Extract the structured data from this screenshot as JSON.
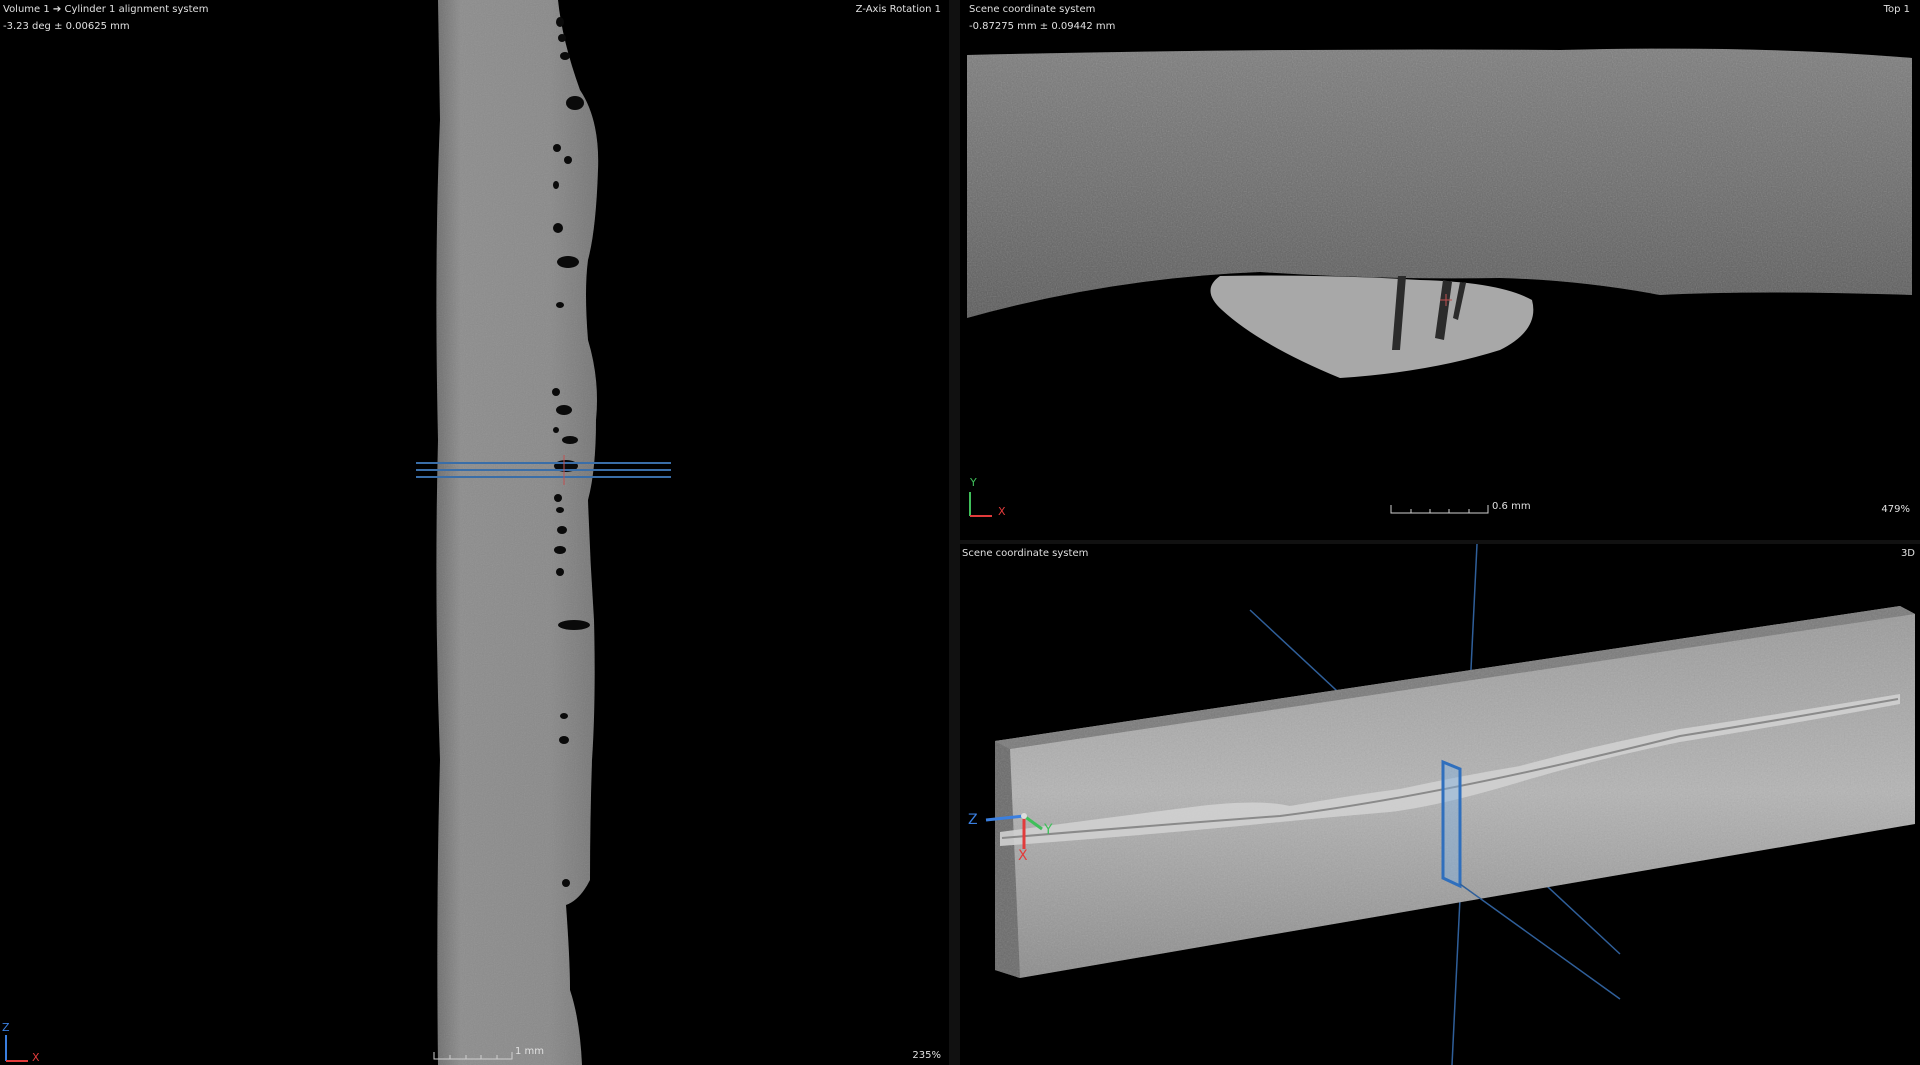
{
  "left_view": {
    "title": "Volume 1 ➔ Cylinder 1 alignment system",
    "measurement": "-3.23 deg ± 0.00625 mm",
    "view_name": "Z-Axis Rotation 1",
    "zoom": "235%",
    "scale_label": "1 mm",
    "axes": {
      "vertical": "Z",
      "horizontal": "X"
    }
  },
  "top_view": {
    "title": "Scene coordinate system",
    "measurement": "-0.87275 mm ± 0.09442 mm",
    "view_name": "Top 1",
    "zoom": "479%",
    "scale_label": "0.6 mm",
    "axes": {
      "vertical": "Y",
      "horizontal": "X"
    }
  },
  "view_3d": {
    "title": "Scene coordinate system",
    "view_name": "3D",
    "axes": {
      "z": "Z",
      "y": "Y",
      "x": "X"
    }
  },
  "colors": {
    "background": "#000000",
    "text": "#e0e0e0",
    "plane_line": "#3a6ea8",
    "axis_x": "#e23b3b",
    "axis_y": "#3fbf5a",
    "axis_z": "#3a7fe0"
  }
}
